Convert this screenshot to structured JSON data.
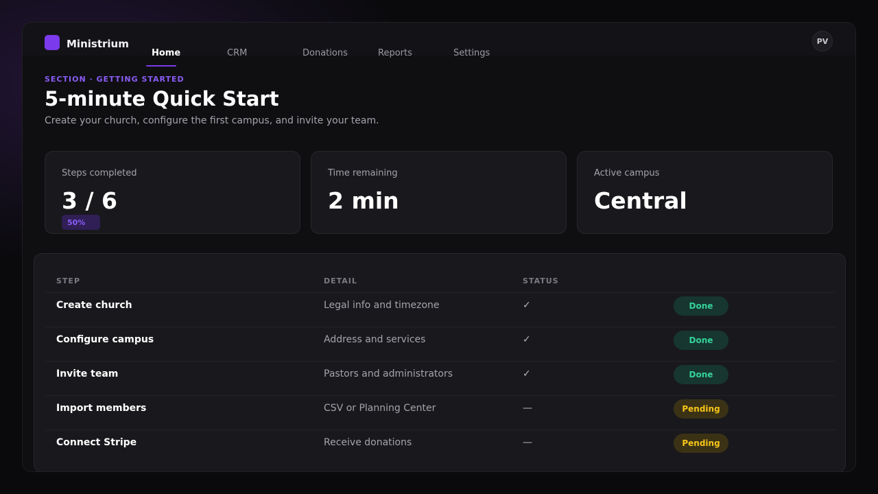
{
  "app": {
    "brand": "Ministrium",
    "user_initials": "PV"
  },
  "nav": {
    "items": [
      {
        "label": "Home",
        "active": true
      },
      {
        "label": "CRM",
        "active": false
      },
      {
        "label": "Donations",
        "active": false
      },
      {
        "label": "Reports",
        "active": false
      },
      {
        "label": "Settings",
        "active": false
      }
    ]
  },
  "header": {
    "eyebrow": "SECTION · GETTING STARTED",
    "title": "5-minute Quick Start",
    "subtitle": "Create your church, configure the first campus, and invite your team."
  },
  "stats": [
    {
      "label": "Steps completed",
      "value": "3 / 6",
      "badge": "50%"
    },
    {
      "label": "Time remaining",
      "value": "2 min"
    },
    {
      "label": "Active campus",
      "value": "Central"
    }
  ],
  "table": {
    "columns": [
      "STEP",
      "DETAIL",
      "STATUS"
    ],
    "rows": [
      {
        "step": "Create church",
        "detail": "Legal info and timezone",
        "mark": "✓",
        "status": "Done"
      },
      {
        "step": "Configure campus",
        "detail": "Address and services",
        "mark": "✓",
        "status": "Done"
      },
      {
        "step": "Invite team",
        "detail": "Pastors and administrators",
        "mark": "✓",
        "status": "Done"
      },
      {
        "step": "Import members",
        "detail": "CSV or Planning Center",
        "mark": "—",
        "status": "Pending"
      },
      {
        "step": "Connect Stripe",
        "detail": "Receive donations",
        "mark": "—",
        "status": "Pending"
      }
    ]
  },
  "colors": {
    "accent": "#7c3aed",
    "done": "#34d399",
    "pending": "#f5c518"
  }
}
